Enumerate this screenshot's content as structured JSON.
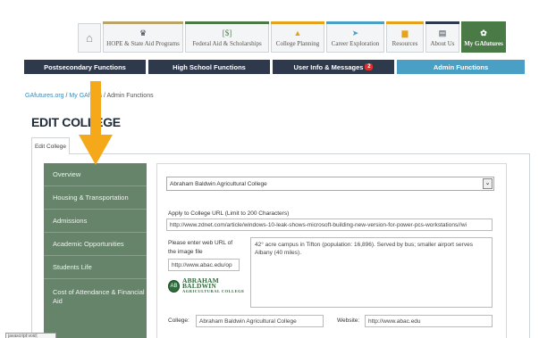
{
  "top_nav": {
    "items": [
      {
        "label": "HOPE & State Aid Programs",
        "icon": "graduation-cap-icon",
        "glyph": "🎓",
        "accent": "#b9a46a"
      },
      {
        "label": "Federal Aid & Scholarships",
        "icon": "money-icon",
        "glyph": "[$]",
        "accent": "#4a7a45"
      },
      {
        "label": "College Planning",
        "icon": "mortarboard-icon",
        "glyph": "🎓",
        "accent": "#e6a21b"
      },
      {
        "label": "Career Exploration",
        "icon": "paper-plane-icon",
        "glyph": "➤",
        "accent": "#4a9fc4"
      },
      {
        "label": "Resources",
        "icon": "folder-icon",
        "glyph": "▆",
        "accent": "#e6a21b"
      },
      {
        "label": "About Us",
        "icon": "id-card-icon",
        "glyph": "▤",
        "accent": "#2e3a4c"
      },
      {
        "label": "My GAfutures",
        "icon": "gear-icon",
        "glyph": "✿",
        "accent": "#4a7a45"
      }
    ],
    "home_glyph": "⌂"
  },
  "functions_bar": {
    "items": [
      {
        "label": "Postsecondary Functions"
      },
      {
        "label": "High School Functions"
      },
      {
        "label": "User Info & Messages",
        "badge": "2"
      },
      {
        "label": "Admin Functions"
      }
    ]
  },
  "breadcrumb": {
    "link1": "GAfutures.org",
    "sep1": " / ",
    "link2": "My GAfutu",
    "rest": "s / Admin Functions"
  },
  "page_title": "EDIT COLLEGE",
  "tab_label": "Edit College",
  "sidebar": {
    "items": [
      {
        "label": "Overview"
      },
      {
        "label": "Housing & Transportation"
      },
      {
        "label": "Admissions"
      },
      {
        "label": "Academic Opportunities"
      },
      {
        "label": "Students Life"
      },
      {
        "label": "Cost of Attendance & Financial Aid"
      }
    ]
  },
  "form": {
    "college_select": "Abraham Baldwin Agricultural College",
    "apply_label": "Apply to College URL (Limit to 200 Characters)",
    "apply_url": "http://www.zdnet.com/article/windows-10-leak-shows-microsoft-building-new-version-for-power-pcs-workstations//wi",
    "image_label_1": "Please enter web URL of",
    "image_label_2": "the image file",
    "image_url": "http://www.abac.edu/op",
    "description": "42° acre campus in Tifton (population: 16,896). Served by bus; smaller airport serves Albany (40 miles).",
    "logo_line1": "ABRAHAM BALDWIN",
    "logo_line2": "AGRICULTURAL COLLEGE",
    "logo_seal": "AB",
    "college_label": "College:",
    "college_value": "Abraham Baldwin Agricultural College",
    "website_label": "Website:",
    "website_value": "http://www.abac.edu"
  },
  "status_text": "javascript:void;",
  "colors": {
    "sidebar": "#65846a",
    "dark_bar": "#2e3a4c",
    "admin_bar": "#4a9fc4",
    "arrow": "#f5a91a",
    "active_nav": "#4a7a45"
  }
}
